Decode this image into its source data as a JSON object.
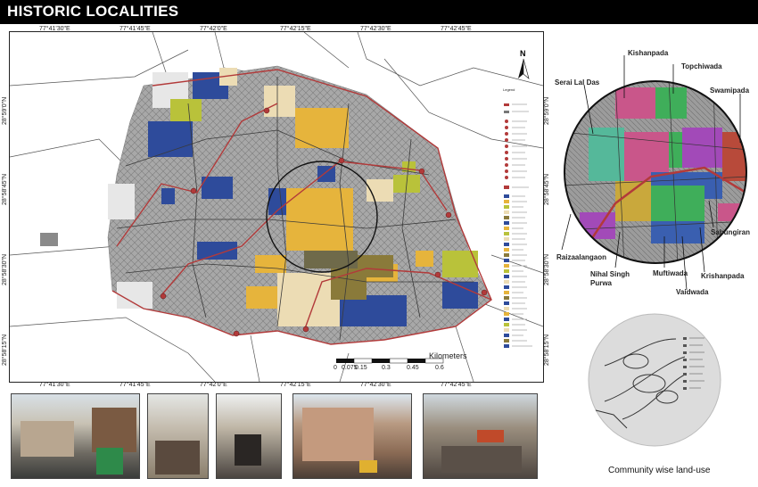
{
  "title": "HISTORIC LOCALITIES",
  "map": {
    "top_coords": [
      "77°41'30\"E",
      "77°41'45\"E",
      "77°42'0\"E",
      "77°42'15\"E",
      "77°42'30\"E",
      "77°42'45\"E"
    ],
    "bottom_coords": [
      "77°41'30\"E",
      "77°41'45\"E",
      "77°42'0\"E",
      "77°42'15\"E",
      "77°42'30\"E",
      "77°42'45\"E"
    ],
    "left_coords": [
      "28°59'0\"N",
      "28°58'45\"N",
      "28°58'30\"N",
      "28°58'15\"N"
    ],
    "right_coords": [
      "28°59'0\"N",
      "28°58'45\"N",
      "28°58'30\"N",
      "28°58'15\"N"
    ],
    "north_label": "N",
    "scale": {
      "unit_label": "Kilometers",
      "ticks": [
        "0",
        "0.075",
        "0.15",
        "0.3",
        "0.45",
        "0.6"
      ]
    },
    "legend_title": "Legend",
    "colors": {
      "blue": "#2e4b9b",
      "yellow": "#e6b43c",
      "olive": "#b9c23a",
      "beige": "#ecdcb4",
      "brown": "#8a7a3a",
      "road": "#b23a3a",
      "built": "#9a9a9a"
    }
  },
  "inset": {
    "localities": [
      "Kishanpada",
      "Topchiwada",
      "Serai Lal Das",
      "Swamipada",
      "Raizaalangaon",
      "Sabungiran",
      "Nihal Singh Purwa",
      "Muftiwada",
      "Krishanpada",
      "Vaidwada"
    ],
    "colors": [
      "#c9568a",
      "#3fae5a",
      "#55b89a",
      "#a24ab8",
      "#b84a3a",
      "#3a5fb0",
      "#c9a83c",
      "#7a3aa8"
    ]
  },
  "sketch_caption": "Community wise land-use",
  "photos": [
    "street-photo-1",
    "street-photo-2",
    "street-photo-3",
    "street-photo-4",
    "street-photo-5"
  ]
}
